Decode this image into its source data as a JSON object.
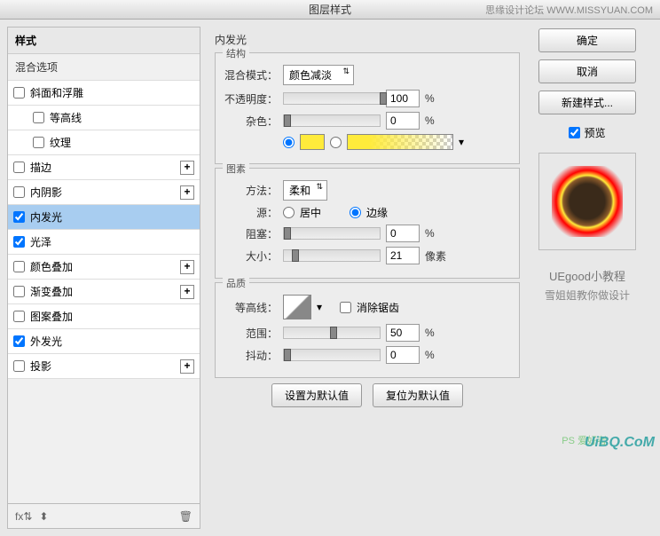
{
  "title": "图层样式",
  "corner": "思缘设计论坛  WWW.MISSYUAN.COM",
  "left": {
    "header": "样式",
    "sub": "混合选项",
    "items": [
      {
        "label": "斜面和浮雕",
        "checked": false,
        "fx": false
      },
      {
        "label": "等高线",
        "checked": false,
        "fx": false,
        "indent": true
      },
      {
        "label": "纹理",
        "checked": false,
        "fx": false,
        "indent": true
      },
      {
        "label": "描边",
        "checked": false,
        "fx": true
      },
      {
        "label": "内阴影",
        "checked": false,
        "fx": true
      },
      {
        "label": "内发光",
        "checked": true,
        "fx": false,
        "selected": true
      },
      {
        "label": "光泽",
        "checked": true,
        "fx": false
      },
      {
        "label": "颜色叠加",
        "checked": false,
        "fx": true
      },
      {
        "label": "渐变叠加",
        "checked": false,
        "fx": true
      },
      {
        "label": "图案叠加",
        "checked": false,
        "fx": false
      },
      {
        "label": "外发光",
        "checked": true,
        "fx": false
      },
      {
        "label": "投影",
        "checked": false,
        "fx": true
      }
    ],
    "footer_fx": "fx⇅"
  },
  "center": {
    "title": "内发光",
    "group1": {
      "title": "结构",
      "blend_label": "混合模式：",
      "blend_value": "颜色减淡",
      "opacity_label": "不透明度：",
      "opacity_value": "100",
      "pct": "%",
      "noise_label": "杂色：",
      "noise_value": "0",
      "color": "#ffeb3b"
    },
    "group2": {
      "title": "图素",
      "method_label": "方法：",
      "method_value": "柔和",
      "source_label": "源：",
      "source_center": "居中",
      "source_edge": "边缘",
      "choke_label": "阻塞：",
      "choke_value": "0",
      "size_label": "大小：",
      "size_value": "21",
      "px": "像素"
    },
    "group3": {
      "title": "品质",
      "contour_label": "等高线：",
      "antialias": "消除锯齿",
      "range_label": "范围：",
      "range_value": "50",
      "jitter_label": "抖动：",
      "jitter_value": "0"
    },
    "btn_default": "设置为默认值",
    "btn_reset": "复位为默认值"
  },
  "right": {
    "ok": "确定",
    "cancel": "取消",
    "new_style": "新建样式...",
    "preview": "预览",
    "tut_title": "UEgood小教程",
    "tut_sub": "雪姐姐教你做设计"
  },
  "wm1": "UiBQ.CoM",
  "wm2": "PS 爱好者"
}
